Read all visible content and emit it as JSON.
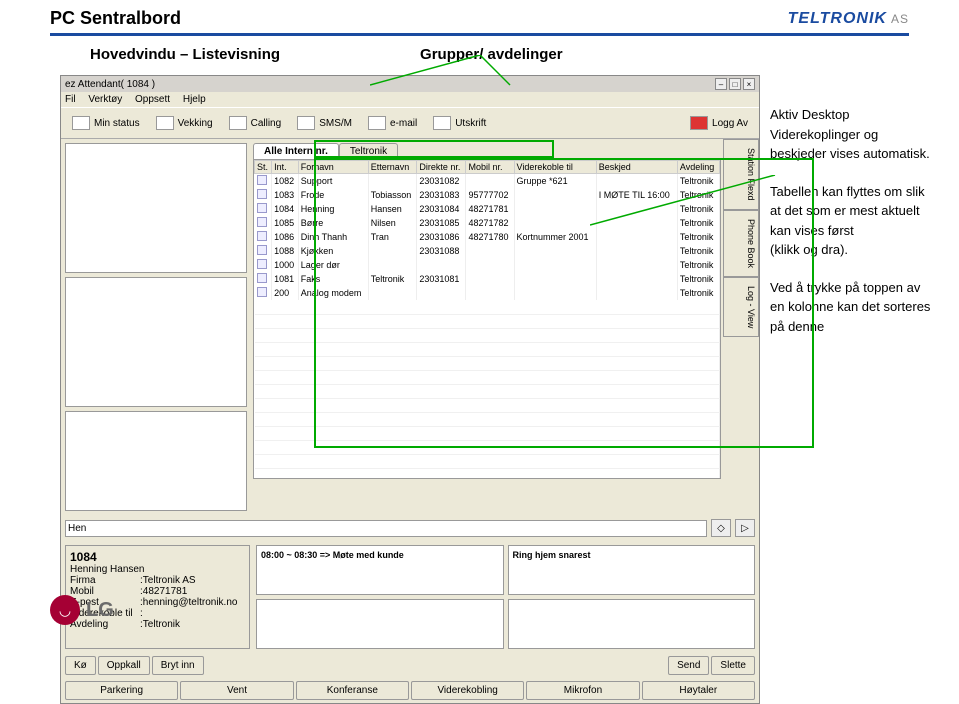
{
  "header": {
    "title": "PC Sentralbord",
    "brand": "TELTRONIK",
    "brand_suffix": "AS"
  },
  "subtitles": {
    "left": "Hovedvindu – Listevisning",
    "right": "Grupper/ avdelinger"
  },
  "window": {
    "title": "ez Attendant( 1084 )"
  },
  "menu": {
    "file": "Fil",
    "tools": "Verktøy",
    "setup": "Oppsett",
    "help": "Hjelp"
  },
  "toolbar": {
    "status": "Min status",
    "wake": "Vekking",
    "calling": "Calling",
    "sms": "SMS/M",
    "email": "e-mail",
    "print": "Utskrift",
    "logoff": "Logg Av"
  },
  "tabs": {
    "all": "Alle Intern nr.",
    "teltronik": "Teltronik"
  },
  "columns": {
    "st": "St.",
    "int": "Int.",
    "first": "Fornavn",
    "last": "Etternavn",
    "direct": "Direkte nr.",
    "mobile": "Mobil nr.",
    "forward": "Viderekoble til",
    "msg": "Beskjed",
    "dept": "Avdeling"
  },
  "rows": [
    {
      "int": "1082",
      "first": "Support",
      "last": "",
      "direct": "23031082",
      "mobile": "",
      "forward": "Gruppe *621",
      "msg": "",
      "dept": "Teltronik"
    },
    {
      "int": "1083",
      "first": "Frode",
      "last": "Tobiasson",
      "direct": "23031083",
      "mobile": "95777702",
      "forward": "",
      "msg": "I MØTE TIL 16:00",
      "dept": "Teltronik"
    },
    {
      "int": "1084",
      "first": "Henning",
      "last": "Hansen",
      "direct": "23031084",
      "mobile": "48271781",
      "forward": "",
      "msg": "",
      "dept": "Teltronik"
    },
    {
      "int": "1085",
      "first": "Børre",
      "last": "Nilsen",
      "direct": "23031085",
      "mobile": "48271782",
      "forward": "",
      "msg": "",
      "dept": "Teltronik"
    },
    {
      "int": "1086",
      "first": "Dinh Thanh",
      "last": "Tran",
      "direct": "23031086",
      "mobile": "48271780",
      "forward": "Kortnummer 2001",
      "msg": "",
      "dept": "Teltronik"
    },
    {
      "int": "1088",
      "first": "Kjøkken",
      "last": "",
      "direct": "23031088",
      "mobile": "",
      "forward": "",
      "msg": "",
      "dept": "Teltronik"
    },
    {
      "int": "1000",
      "first": "Lager dør",
      "last": "",
      "direct": "",
      "mobile": "",
      "forward": "",
      "msg": "",
      "dept": "Teltronik"
    },
    {
      "int": "1081",
      "first": "Faks",
      "last": "Teltronik",
      "direct": "23031081",
      "mobile": "",
      "forward": "",
      "msg": "",
      "dept": "Teltronik"
    },
    {
      "int": "200",
      "first": "Analog modem",
      "last": "",
      "direct": "",
      "mobile": "",
      "forward": "",
      "msg": "",
      "dept": "Teltronik"
    }
  ],
  "side_tabs": {
    "station": "Station Flexd",
    "phonebook": "Phone Book",
    "log": "Log - View"
  },
  "search": {
    "value": "Hen"
  },
  "info": {
    "ext": "1084",
    "name": "Henning Hansen",
    "firm_lbl": "Firma",
    "firm": "Teltronik AS",
    "mobile_lbl": "Mobil",
    "mobile": "48271781",
    "email_lbl": "E-post",
    "email": "henning@teltronik.no",
    "fwd_lbl": "Viderekoble til",
    "fwd": "",
    "dept_lbl": "Avdeling",
    "dept": "Teltronik"
  },
  "msgs": {
    "m1": "08:00 ~ 08:30 => Møte med kunde",
    "m2": "Ring hjem snarest"
  },
  "btns1": {
    "queue": "Kø",
    "call": "Oppkall",
    "break": "Bryt inn",
    "send": "Send",
    "delete": "Slette"
  },
  "btns2": {
    "park": "Parkering",
    "wait": "Vent",
    "conf": "Konferanse",
    "fwd": "Viderekobling",
    "mic": "Mikrofon",
    "spk": "Høytaler"
  },
  "anno": {
    "p1a": "Aktiv Desktop",
    "p1b": "Viderekoplinger og",
    "p1c": "beskjeder vises automatisk.",
    "p2a": "Tabellen kan flyttes om slik",
    "p2b": "at det som er mest aktuelt",
    "p2c": "kan vises først",
    "p2d": "(klikk og dra).",
    "p3a": "Ved å trykke på toppen av",
    "p3b": "en kolonne kan det sorteres",
    "p3c": "på denne"
  },
  "lg": {
    "text": "LG"
  }
}
